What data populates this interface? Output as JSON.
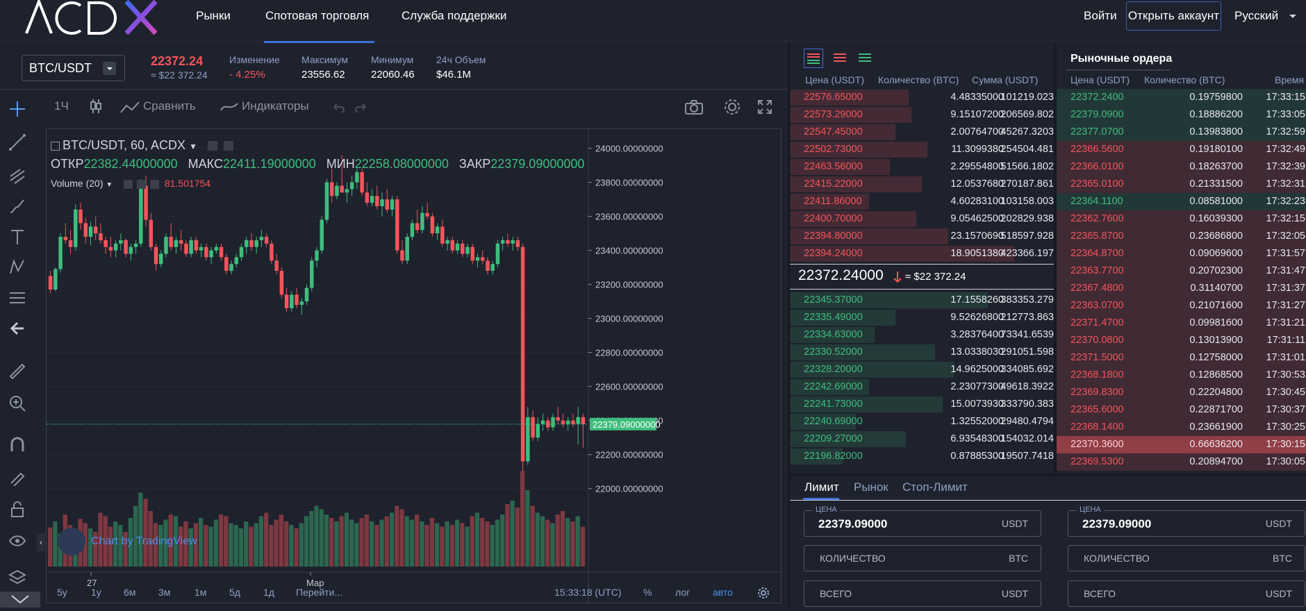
{
  "nav": {
    "links": [
      "Рынки",
      "Спотовая торговля",
      "Служба поддержки"
    ],
    "login": "Войти",
    "open_account": "Открыть аккаунт",
    "language": "Русский",
    "accent": "#3f74d9"
  },
  "ticker": {
    "pair": "BTC/USDT",
    "last_price": "22372.24",
    "last_price_usd": "≈ $22 372.24",
    "change_label": "Изменение",
    "change_value": "- 4.25%",
    "max_label": "Максимум",
    "max_value": "23556.62",
    "min_label": "Минимум",
    "min_value": "22060.46",
    "vol_label": "24ч Объем",
    "vol_value": "$46.1M"
  },
  "chart_toolbar": {
    "interval": "1Ч",
    "compare": "Сравнить",
    "indicators": "Индикаторы"
  },
  "chart_legend": {
    "symbol": "BTC/USDT, 60, ACDX",
    "open_label": "ОТКР",
    "open": "22382.44000000",
    "high_label": "МАКС",
    "high": "22411.19000000",
    "low_label": "МИН",
    "low": "22258.08000000",
    "close_label": "ЗАКР",
    "close": "22379.09000000",
    "volume_label": "Volume (20)",
    "volume_value": "81.501754",
    "watermark": "Chart by TradingView"
  },
  "chart_data": {
    "type": "candlestick",
    "y_ticks": [
      "24000.00000000",
      "23800.00000000",
      "23600.00000000",
      "23400.00000000",
      "23200.00000000",
      "23000.00000000",
      "22800.00000000",
      "22600.00000000",
      "22400.00000000",
      "22200.00000000",
      "22000.00000000"
    ],
    "ylim": [
      21950,
      24080
    ],
    "x_ticks": [
      "27",
      "Мар"
    ],
    "last_price_label": "22379.09000000",
    "last_price": 22379.09,
    "candles": [
      [
        23250,
        23280,
        23150,
        23170
      ],
      [
        23170,
        23300,
        23160,
        23290
      ],
      [
        23290,
        23500,
        23270,
        23480
      ],
      [
        23480,
        23560,
        23440,
        23460
      ],
      [
        23460,
        23520,
        23380,
        23420
      ],
      [
        23420,
        23670,
        23400,
        23640
      ],
      [
        23640,
        23680,
        23520,
        23560
      ],
      [
        23560,
        23590,
        23440,
        23480
      ],
      [
        23480,
        23570,
        23430,
        23540
      ],
      [
        23540,
        23600,
        23460,
        23500
      ],
      [
        23500,
        23560,
        23440,
        23460
      ],
      [
        23460,
        23480,
        23380,
        23420
      ],
      [
        23420,
        23480,
        23360,
        23400
      ],
      [
        23400,
        23460,
        23360,
        23440
      ],
      [
        23440,
        23500,
        23400,
        23460
      ],
      [
        23460,
        23470,
        23360,
        23380
      ],
      [
        23380,
        23440,
        23340,
        23420
      ],
      [
        23420,
        23460,
        23380,
        23440
      ],
      [
        23440,
        23820,
        23420,
        23780
      ],
      [
        23780,
        23840,
        23540,
        23580
      ],
      [
        23580,
        23620,
        23400,
        23420
      ],
      [
        23420,
        23440,
        23280,
        23320
      ],
      [
        23320,
        23400,
        23300,
        23380
      ],
      [
        23380,
        23500,
        23360,
        23480
      ],
      [
        23480,
        23560,
        23400,
        23420
      ],
      [
        23420,
        23480,
        23380,
        23460
      ],
      [
        23460,
        23520,
        23400,
        23440
      ],
      [
        23440,
        23460,
        23360,
        23380
      ],
      [
        23380,
        23480,
        23360,
        23460
      ],
      [
        23460,
        23480,
        23380,
        23400
      ],
      [
        23400,
        23440,
        23360,
        23420
      ],
      [
        23420,
        23440,
        23340,
        23360
      ],
      [
        23360,
        23420,
        23320,
        23400
      ],
      [
        23400,
        23440,
        23380,
        23420
      ],
      [
        23420,
        23440,
        23340,
        23360
      ],
      [
        23360,
        23380,
        23260,
        23280
      ],
      [
        23280,
        23340,
        23260,
        23320
      ],
      [
        23320,
        23380,
        23300,
        23360
      ],
      [
        23360,
        23440,
        23340,
        23420
      ],
      [
        23420,
        23480,
        23380,
        23460
      ],
      [
        23460,
        23500,
        23400,
        23420
      ],
      [
        23420,
        23480,
        23380,
        23460
      ],
      [
        23460,
        23520,
        23420,
        23480
      ],
      [
        23480,
        23500,
        23420,
        23440
      ],
      [
        23440,
        23460,
        23320,
        23340
      ],
      [
        23340,
        23380,
        23260,
        23280
      ],
      [
        23280,
        23300,
        23120,
        23140
      ],
      [
        23140,
        23180,
        23040,
        23060
      ],
      [
        23060,
        23160,
        23040,
        23140
      ],
      [
        23140,
        23180,
        23060,
        23080
      ],
      [
        23080,
        23120,
        23020,
        23100
      ],
      [
        23100,
        23200,
        23080,
        23180
      ],
      [
        23180,
        23360,
        23160,
        23340
      ],
      [
        23340,
        23420,
        23300,
        23400
      ],
      [
        23400,
        23600,
        23380,
        23580
      ],
      [
        23580,
        23820,
        23560,
        23800
      ],
      [
        23800,
        23880,
        23680,
        23720
      ],
      [
        23720,
        23800,
        23700,
        23780
      ],
      [
        23780,
        23960,
        23740,
        23740
      ],
      [
        23740,
        23800,
        23680,
        23760
      ],
      [
        23760,
        23840,
        23720,
        23800
      ],
      [
        23800,
        23880,
        23760,
        23860
      ],
      [
        23860,
        23880,
        23720,
        23740
      ],
      [
        23740,
        23800,
        23660,
        23680
      ],
      [
        23680,
        23760,
        23660,
        23720
      ],
      [
        23720,
        23780,
        23640,
        23660
      ],
      [
        23660,
        23740,
        23600,
        23700
      ],
      [
        23700,
        23760,
        23620,
        23640
      ],
      [
        23640,
        23720,
        23600,
        23700
      ],
      [
        23700,
        23720,
        23380,
        23400
      ],
      [
        23400,
        23460,
        23320,
        23340
      ],
      [
        23340,
        23500,
        23320,
        23480
      ],
      [
        23480,
        23580,
        23460,
        23560
      ],
      [
        23560,
        23640,
        23500,
        23520
      ],
      [
        23520,
        23660,
        23500,
        23620
      ],
      [
        23620,
        23680,
        23580,
        23600
      ],
      [
        23600,
        23620,
        23480,
        23500
      ],
      [
        23500,
        23560,
        23460,
        23540
      ],
      [
        23540,
        23580,
        23420,
        23440
      ],
      [
        23440,
        23480,
        23400,
        23460
      ],
      [
        23460,
        23480,
        23380,
        23400
      ],
      [
        23400,
        23460,
        23380,
        23440
      ],
      [
        23440,
        23460,
        23360,
        23380
      ],
      [
        23380,
        23440,
        23360,
        23420
      ],
      [
        23420,
        23440,
        23320,
        23340
      ],
      [
        23340,
        23380,
        23300,
        23360
      ],
      [
        23360,
        23400,
        23320,
        23340
      ],
      [
        23340,
        23360,
        23260,
        23280
      ],
      [
        23280,
        23340,
        23260,
        23320
      ],
      [
        23320,
        23460,
        23300,
        23440
      ],
      [
        23440,
        23480,
        23400,
        23460
      ],
      [
        23460,
        23500,
        23420,
        23440
      ],
      [
        23440,
        23480,
        23400,
        23460
      ],
      [
        23460,
        23480,
        23400,
        23420
      ],
      [
        23420,
        23440,
        22100,
        22160
      ],
      [
        22160,
        22480,
        22140,
        22420
      ],
      [
        22420,
        22460,
        22280,
        22300
      ],
      [
        22300,
        22420,
        22280,
        22380
      ],
      [
        22380,
        22440,
        22340,
        22400
      ],
      [
        22400,
        22420,
        22340,
        22360
      ],
      [
        22360,
        22440,
        22340,
        22420
      ],
      [
        22420,
        22480,
        22380,
        22400
      ],
      [
        22400,
        22440,
        22360,
        22380
      ],
      [
        22380,
        22420,
        22340,
        22400
      ],
      [
        22400,
        22440,
        22360,
        22380
      ],
      [
        22380,
        22480,
        22260,
        22420
      ],
      [
        22420,
        22440,
        22240,
        22379
      ]
    ],
    "volume_ylim": [
      0,
      120
    ],
    "volumes": [
      45,
      52,
      38,
      60,
      48,
      42,
      55,
      50,
      44,
      40,
      62,
      58,
      46,
      52,
      48,
      40,
      56,
      70,
      85,
      78,
      64,
      50,
      48,
      54,
      60,
      58,
      46,
      52,
      44,
      50,
      56,
      48,
      46,
      54,
      60,
      58,
      50,
      48,
      44,
      52,
      46,
      50,
      58,
      62,
      48,
      54,
      60,
      52,
      48,
      44,
      50,
      58,
      64,
      70,
      66,
      60,
      56,
      52,
      58,
      62,
      54,
      50,
      56,
      60,
      52,
      48,
      54,
      58,
      62,
      70,
      66,
      58,
      54,
      60,
      52,
      48,
      56,
      50,
      46,
      52,
      48,
      54,
      50,
      46,
      58,
      62,
      56,
      52,
      48,
      54,
      60,
      72,
      76,
      68,
      110,
      88,
      70,
      62,
      58,
      54,
      50,
      60,
      64,
      56,
      52,
      58,
      46
    ]
  },
  "chart_bottom": {
    "ranges": [
      "5y",
      "1y",
      "6м",
      "3м",
      "1м",
      "5д",
      "1д"
    ],
    "goto": "Перейти...",
    "time": "15:33:18 (UTC)",
    "percent": "%",
    "log": "лог",
    "auto": "авто"
  },
  "orderbook": {
    "headers": [
      "Цена (USDT)",
      "Количество (BTC)",
      "Сумма (USDT)"
    ],
    "asks": [
      [
        "22576.65000",
        "4.48335000",
        "101219.023"
      ],
      [
        "22573.29000",
        "9.15107200",
        "206569.802"
      ],
      [
        "22547.45000",
        "2.00764700",
        "45267.3203"
      ],
      [
        "22502.73000",
        "11.3099380",
        "254504.481"
      ],
      [
        "22463.56000",
        "2.29554800",
        "51566.1802"
      ],
      [
        "22415.22000",
        "12.0537680",
        "270187.861"
      ],
      [
        "22411.86000",
        "4.60283100",
        "103158.003"
      ],
      [
        "22400.70000",
        "9.05462500",
        "202829.938"
      ],
      [
        "22394.80000",
        "23.1570690",
        "518597.928"
      ],
      [
        "22394.24000",
        "18.9051380",
        "423366.197"
      ]
    ],
    "mid_price": "22372.24000",
    "mid_usd": "≈ $22 372.24",
    "bids": [
      [
        "22345.37000",
        "17.1558260",
        "383353.279"
      ],
      [
        "22335.49000",
        "9.52626800",
        "212773.863"
      ],
      [
        "22334.63000",
        "3.28376400",
        "73341.6539"
      ],
      [
        "22330.52000",
        "13.0338030",
        "291051.598"
      ],
      [
        "22328.20000",
        "14.9625000",
        "334085.692"
      ],
      [
        "22242.69000",
        "2.23077300",
        "49618.3922"
      ],
      [
        "22241.73000",
        "15.0073930",
        "333790.383"
      ],
      [
        "22240.69000",
        "1.32552000",
        "29480.4794"
      ],
      [
        "22209.27000",
        "6.93548300",
        "154032.014"
      ],
      [
        "22196.82000",
        "0.87885300",
        "19507.7418"
      ]
    ],
    "ask_depth": [
      0.45,
      0.46,
      0.4,
      0.52,
      0.38,
      0.5,
      0.3,
      0.48,
      0.6,
      0.85
    ],
    "bid_depth": [
      0.75,
      0.4,
      0.32,
      0.55,
      0.62,
      0.3,
      0.58,
      0.25,
      0.44,
      0.2
    ]
  },
  "market_trades": {
    "title": "Рыночные ордера",
    "headers": [
      "Цена (USDT)",
      "Количество (BTC)",
      "Время"
    ],
    "rows": [
      [
        "22372.2400",
        "0.19759800",
        "17:33:15",
        "buy"
      ],
      [
        "22379.0900",
        "0.18886200",
        "17:33:05",
        "buy"
      ],
      [
        "22377.0700",
        "0.13983800",
        "17:32:59",
        "buy"
      ],
      [
        "22366.5600",
        "0.19180100",
        "17:32:49",
        "sell"
      ],
      [
        "22366.0100",
        "0.18263700",
        "17:32:39",
        "sell"
      ],
      [
        "22365.0100",
        "0.21331500",
        "17:32:31",
        "sell"
      ],
      [
        "22364.1100",
        "0.08581000",
        "17:32:23",
        "buy"
      ],
      [
        "22362.7600",
        "0.16039300",
        "17:32:15",
        "sell"
      ],
      [
        "22365.8700",
        "0.23686800",
        "17:32:05",
        "sell"
      ],
      [
        "22364.8700",
        "0.09069600",
        "17:31:57",
        "sell"
      ],
      [
        "22363.7700",
        "0.20702300",
        "17:31:47",
        "sell"
      ],
      [
        "22367.4800",
        "0.31140700",
        "17:31:37",
        "sell"
      ],
      [
        "22363.0700",
        "0.21071600",
        "17:31:27",
        "sell"
      ],
      [
        "22371.4700",
        "0.09981600",
        "17:31:21",
        "sell"
      ],
      [
        "22370.0800",
        "0.13013900",
        "17:31:11",
        "sell"
      ],
      [
        "22371.5000",
        "0.12758000",
        "17:31:01",
        "sell"
      ],
      [
        "22368.1800",
        "0.12868500",
        "17:30:53",
        "sell"
      ],
      [
        "22369.8300",
        "0.22204800",
        "17:30:45",
        "sell"
      ],
      [
        "22365.6000",
        "0.22871700",
        "17:30:37",
        "sell"
      ],
      [
        "22368.1400",
        "0.23661900",
        "17:30:25",
        "sell"
      ],
      [
        "22370.3600",
        "0.66636200",
        "17:30:15",
        "sell-big"
      ],
      [
        "22369.5300",
        "0.20894700",
        "17:30:05",
        "sell"
      ]
    ]
  },
  "order_form": {
    "tabs": [
      "Лимит",
      "Рынок",
      "Стоп-Лимит"
    ],
    "price_label": "ЦЕНА",
    "price_value": "22379.09000",
    "price_unit": "USDT",
    "qty_label": "КОЛИЧЕСТВО",
    "qty_unit": "BTC",
    "total_label": "ВСЕГО",
    "total_unit": "USDT"
  },
  "colors": {
    "up": "#3fbd7d",
    "down": "#f2555b",
    "bg": "#1e222d"
  }
}
